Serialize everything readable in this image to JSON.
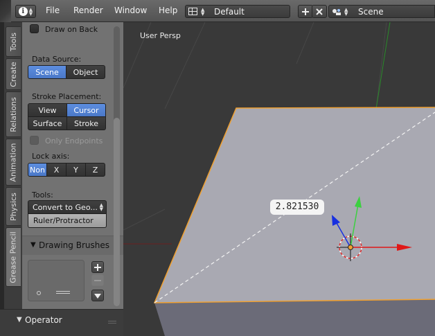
{
  "menu": {
    "items": [
      "File",
      "Render",
      "Window",
      "Help"
    ],
    "screen_layout": "Default",
    "scene": "Scene"
  },
  "tabs": [
    "Tools",
    "Create",
    "Relations",
    "Animation",
    "Physics",
    "Grease Pencil"
  ],
  "active_tab": "Grease Pencil",
  "toolshelf": {
    "draw_on_back": "Draw on Back",
    "data_source_label": "Data Source:",
    "data_source_options": [
      "Scene",
      "Object"
    ],
    "data_source_active": "Scene",
    "stroke_placement_label": "Stroke Placement:",
    "stroke_placement_options": [
      "View",
      "Cursor",
      "Surface",
      "Stroke"
    ],
    "stroke_placement_active": "Cursor",
    "only_endpoints": "Only Endpoints",
    "lock_axis_label": "Lock axis:",
    "lock_axis_options": [
      "Non",
      "X",
      "Y",
      "Z"
    ],
    "lock_axis_active": "Non",
    "tools_label": "Tools:",
    "tools_dropdown": "Convert to Geo...",
    "ruler_button": "Ruler/Protractor",
    "drawing_brushes_title": "Drawing Brushes"
  },
  "operator": {
    "title": "Operator"
  },
  "viewport": {
    "label": "User Persp",
    "measure_value": "2.821530"
  },
  "colors": {
    "accent_blue": "#5680d0",
    "panel_gray": "#727272",
    "selection_orange": "#f0a030",
    "axis_x": "#e01818",
    "axis_y": "#3cd040",
    "axis_z": "#1830e0"
  }
}
